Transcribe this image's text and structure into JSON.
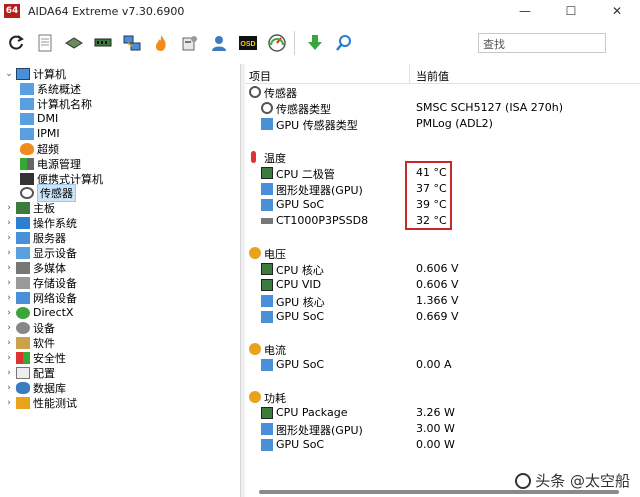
{
  "window": {
    "logo_text": "64",
    "title": "AIDA64 Extreme v7.30.6900",
    "minimize": "—",
    "maximize": "☐",
    "close": "✕"
  },
  "toolbar": {
    "search_placeholder": "查找",
    "icons": [
      "refresh-icon",
      "report-icon",
      "motherboard-icon",
      "memory-icon",
      "network-icon",
      "flame-icon",
      "tools-icon",
      "user-icon",
      "osd-icon",
      "gauge-icon",
      "download-icon",
      "search-icon"
    ],
    "osd_label": "OSD"
  },
  "tree": {
    "root": "计算机",
    "children": [
      "系统概述",
      "计算机名称",
      "DMI",
      "IPMI",
      "超频",
      "电源管理",
      "便携式计算机",
      "传感器"
    ],
    "top": [
      "主板",
      "操作系统",
      "服务器",
      "显示设备",
      "多媒体",
      "存储设备",
      "网络设备",
      "DirectX",
      "设备",
      "软件",
      "安全性",
      "配置",
      "数据库",
      "性能测试"
    ]
  },
  "columns": {
    "item": "项目",
    "value": "当前值"
  },
  "sections": {
    "sensor": {
      "title": "传感器",
      "rows": [
        {
          "label": "传感器类型",
          "value": "SMSC SCH5127  (ISA 270h)"
        },
        {
          "label": "GPU 传感器类型",
          "value": "PMLog  (ADL2)"
        }
      ]
    },
    "temp": {
      "title": "温度",
      "rows": [
        {
          "label": "CPU 二极管",
          "value": "41 °C"
        },
        {
          "label": "图形处理器(GPU)",
          "value": "37 °C"
        },
        {
          "label": "GPU SoC",
          "value": "39 °C"
        },
        {
          "label": "CT1000P3PSSD8",
          "value": "32 °C"
        }
      ]
    },
    "voltage": {
      "title": "电压",
      "rows": [
        {
          "label": "CPU 核心",
          "value": "0.606 V"
        },
        {
          "label": "CPU VID",
          "value": "0.606 V"
        },
        {
          "label": "GPU 核心",
          "value": "1.366 V"
        },
        {
          "label": "GPU SoC",
          "value": "0.669 V"
        }
      ]
    },
    "current": {
      "title": "电流",
      "rows": [
        {
          "label": "GPU SoC",
          "value": "0.00 A"
        }
      ]
    },
    "power": {
      "title": "功耗",
      "rows": [
        {
          "label": "CPU Package",
          "value": "3.26 W"
        },
        {
          "label": "图形处理器(GPU)",
          "value": "3.00 W"
        },
        {
          "label": "GPU SoC",
          "value": "0.00 W"
        }
      ]
    }
  },
  "watermark": "头条 @太空船",
  "colors": {
    "highlight": "#c62828",
    "selection": "#cce4f7",
    "logo": "#b2201d"
  }
}
